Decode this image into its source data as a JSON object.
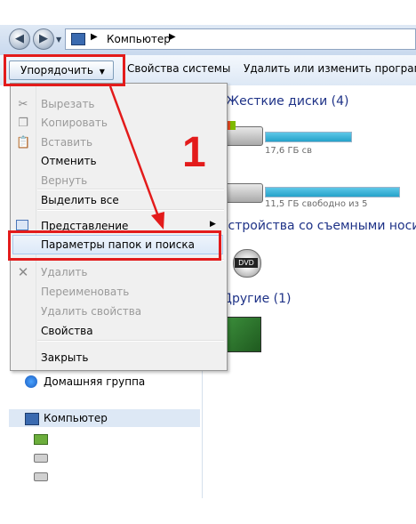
{
  "address": {
    "path": "Компьютер"
  },
  "toolbar": {
    "arrange": "Упорядочить",
    "system_props": "Свойства системы",
    "uninstall": "Удалить или изменить программу"
  },
  "content": {
    "hdd_group": "Жесткие диски (4)",
    "drive1_info": "17,6 ГБ св",
    "drive2_info": "11,5 ГБ свободно из 5",
    "removable_group": "Устройства со съемными носит",
    "dvd_label": "DVD",
    "other_group": "Другие (1)"
  },
  "nav": {
    "homegroup": "Домашняя группа",
    "computer": "Компьютер"
  },
  "menu": {
    "cut": "Вырезать",
    "copy": "Копировать",
    "paste": "Вставить",
    "undo": "Отменить",
    "redo": "Вернуть",
    "select_all": "Выделить все",
    "view": "Представление",
    "folder_options": "Параметры папок и поиска",
    "delete": "Удалить",
    "rename": "Переименовать",
    "remove_props": "Удалить свойства",
    "properties": "Свойства",
    "close": "Закрыть"
  },
  "annotation": {
    "step": "1"
  },
  "colors": {
    "highlight_red": "#e31b1b",
    "link_blue": "#1e3287"
  }
}
